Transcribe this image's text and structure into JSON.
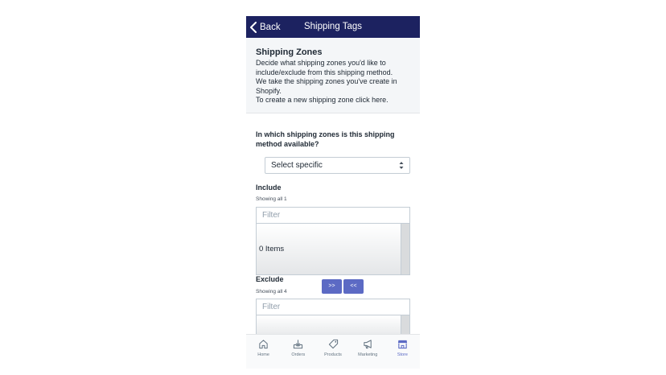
{
  "navbar": {
    "back_label": "Back",
    "title": "Shipping Tags"
  },
  "zones": {
    "title": "Shipping Zones",
    "line1": "Decide what shipping zones you'd like to",
    "line2": "include/exclude from this shipping method.",
    "line3": "We take the shipping zones you've create in",
    "line4": "Shopify.",
    "link_text": "To create a new shipping zone click here."
  },
  "question": "In which shipping zones is this shipping method available?",
  "select": {
    "value": "Select specific"
  },
  "include": {
    "label": "Include",
    "showing": "Showing all 1",
    "filter_placeholder": "Filter",
    "items_label": "0 Items"
  },
  "exclude": {
    "label": "Exclude",
    "showing": "Showing all 4",
    "filter_placeholder": "Filter"
  },
  "move_buttons": {
    "add": ">>",
    "remove": "<<"
  },
  "tabbar": {
    "home": "Home",
    "orders": "Orders",
    "products": "Products",
    "marketing": "Marketing",
    "store": "Store"
  },
  "colors": {
    "navbar": "#1c2260",
    "accent": "#5c6ac4",
    "panel": "#f4f6f8"
  }
}
